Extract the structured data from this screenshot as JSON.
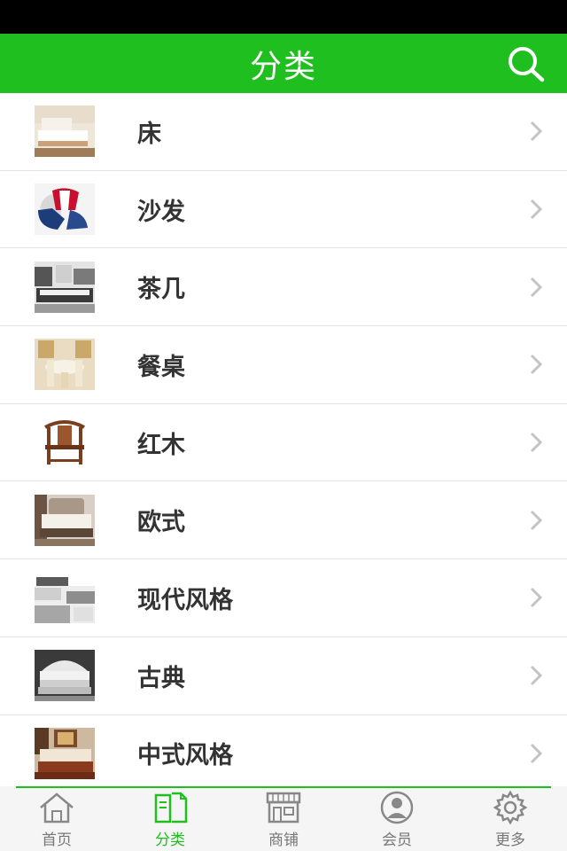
{
  "header": {
    "title": "分类"
  },
  "categories": [
    {
      "label": "床",
      "thumb": "bed"
    },
    {
      "label": "沙发",
      "thumb": "sofa"
    },
    {
      "label": "茶几",
      "thumb": "tea-table"
    },
    {
      "label": "餐桌",
      "thumb": "dining-table"
    },
    {
      "label": "红木",
      "thumb": "rosewood-chair"
    },
    {
      "label": "欧式",
      "thumb": "european-bed"
    },
    {
      "label": "现代风格",
      "thumb": "modern-room"
    },
    {
      "label": "古典",
      "thumb": "classic-bed"
    },
    {
      "label": "中式风格",
      "thumb": "chinese-bed"
    }
  ],
  "tabbar": {
    "tabs": [
      {
        "label": "首页",
        "icon": "home-icon"
      },
      {
        "label": "分类",
        "icon": "category-icon"
      },
      {
        "label": "商铺",
        "icon": "store-icon"
      },
      {
        "label": "会员",
        "icon": "member-icon"
      },
      {
        "label": "更多",
        "icon": "more-gear-icon"
      }
    ],
    "active_tab": "分类"
  },
  "colors": {
    "accent": "#1ebf1e",
    "status_bar": "#000000",
    "text": "#333333",
    "tab_inactive": "#777777"
  }
}
